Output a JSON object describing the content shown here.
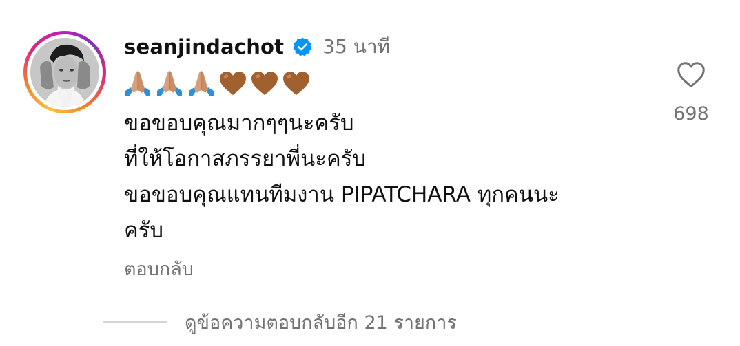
{
  "comment": {
    "username": "seanjindachot",
    "verified_icon": "verified-badge-icon",
    "timestamp": "35 นาที",
    "emojis": [
      "folded-hands-icon",
      "folded-hands-icon",
      "folded-hands-icon",
      "brown-heart-icon",
      "brown-heart-icon",
      "brown-heart-icon"
    ],
    "text_lines": [
      "ขอขอบคุณมากๆๆนะครับ",
      "ที่ให้โอกาสภรรยาพี่นะครับ",
      "ขอขอบคุณแทนทีมงาน PIPATCHARA ทุกคนนะ",
      "ครับ"
    ],
    "reply_label": "ตอบกลับ",
    "like_icon": "heart-outline-icon",
    "like_count": "698",
    "view_replies_label": "ดูข้อความตอบกลับอีก 21 รายการ"
  },
  "colors": {
    "text_primary": "#111111",
    "text_secondary": "#737373",
    "verified_blue": "#0095f6",
    "brown_heart": "#a0612f",
    "divider": "#d4d4d4"
  }
}
